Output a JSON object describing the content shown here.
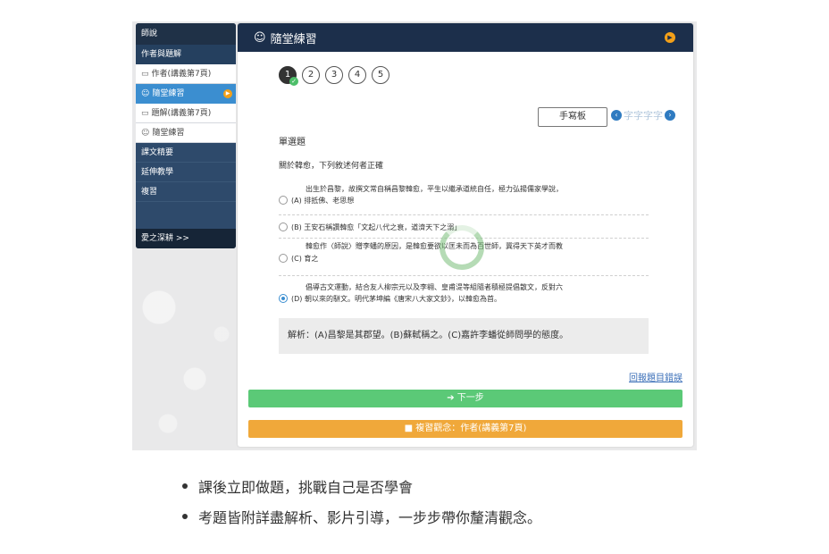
{
  "sidebar": {
    "items": [
      {
        "label": "師說"
      },
      {
        "label": "作者與題解"
      },
      {
        "label": "作者(講義第7頁)"
      },
      {
        "label": "隨堂練習"
      },
      {
        "label": "題解(講義第7頁)"
      },
      {
        "label": "隨堂練習"
      },
      {
        "label": "課文精要"
      },
      {
        "label": "延伸教學"
      },
      {
        "label": "複習"
      }
    ],
    "footer": "愛之深耕 >>"
  },
  "panel": {
    "title": "隨堂練習",
    "steps": [
      "1",
      "2",
      "3",
      "4",
      "5"
    ],
    "handwriting_button": "手寫板",
    "font_size_label": "字字字字",
    "question_type": "單選題",
    "question_stem": "關於韓愈，下列敘述何者正確",
    "options": [
      {
        "lines": [
          "出生於昌黎，故撰文常自稱昌黎韓愈，平生以繼承道統自任，極力弘揚儒家學說，",
          "(A) 排抵佛、老思想"
        ]
      },
      {
        "lines": [
          "(B) 王安石稱讚韓愈「文起八代之衰，道濟天下之溺」"
        ]
      },
      {
        "lines": [
          "韓愈作〈師說〉贈李蟠的原因，是韓愈要欲以匡未而為百世師，冀得天下英才而教",
          "(C) 育之"
        ]
      },
      {
        "lines": [
          "倡導古文運動，結合友人柳宗元以及李翱、皇甫湜等組隨者積極提倡散文，反對六",
          "(D) 朝以來的駢文。明代茅坤編《唐宋八大家文鈔》，以韓愈為首。"
        ]
      }
    ],
    "selected_option": "D",
    "analysis": "解析：(A)昌黎是其郡望。(B)蘇軾稱之。(C)嘉許李蟠從師問學的態度。",
    "back_link": "回報題目錯誤",
    "next_button": "下一步",
    "review_button": "複習觀念：作者(講義第7頁)"
  },
  "bullets": [
    "課後立即做題，挑戰自己是否學會",
    "考題皆附詳盡解析、影片引導，一步步帶你釐清觀念。"
  ],
  "colors": {
    "header_bg": "#1c2f4b",
    "sidebar_bg": "#2e4a6b",
    "active_item": "#3b8ed0",
    "next_green": "#5bc977",
    "review_orange": "#f0a83a",
    "play_orange": "#f3a019"
  }
}
